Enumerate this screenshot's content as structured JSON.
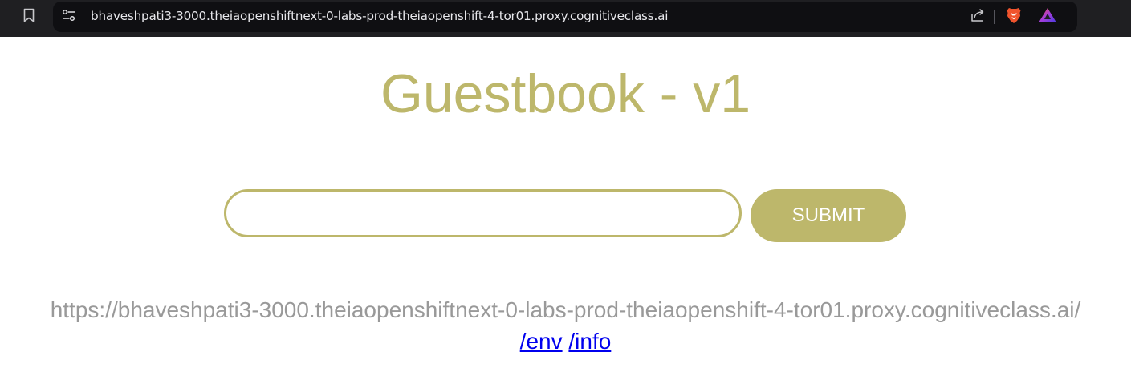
{
  "browser": {
    "url": "bhaveshpati3-3000.theiaopenshiftnext-0-labs-prod-theiaopenshift-4-tor01.proxy.cognitiveclass.ai",
    "icons": {
      "bookmark": "bookmark-icon",
      "site_info": "site-settings-icon",
      "share": "share-icon",
      "brave_shields": "brave-lion-icon",
      "rewards": "brave-rewards-triangle-icon"
    }
  },
  "page": {
    "title": "Guestbook - v1",
    "input": {
      "value": "",
      "placeholder": ""
    },
    "submit_label": "SUBMIT",
    "host_address": "https://bhaveshpati3-3000.theiaopenshiftnext-0-labs-prod-theiaopenshift-4-tor01.proxy.cognitiveclass.ai/",
    "links": [
      {
        "label": "/env"
      },
      {
        "label": "/info"
      }
    ]
  },
  "colors": {
    "accent": "#bdb76b",
    "host_text": "#999999",
    "link": "#0000ee",
    "browser_bar": "#1f1f22",
    "url_field": "#0f0f12"
  }
}
